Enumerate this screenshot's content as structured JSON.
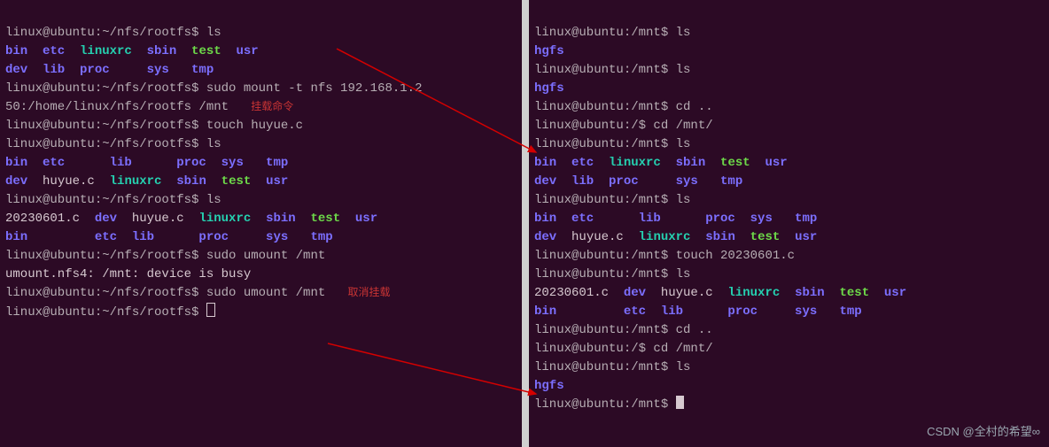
{
  "left": {
    "l1": "linux@ubuntu:~/nfs/rootfs$ ls",
    "ls1_a": "bin  etc  linuxrc  sbin  test  usr",
    "ls1_b": "dev  lib  proc     sys   tmp",
    "l2a": "linux@ubuntu:~/nfs/rootfs$ sudo mount -t nfs 192.168.1.2",
    "l2b": "50:/home/linux/nfs/rootfs /mnt",
    "note1": "挂载命令",
    "l3": "linux@ubuntu:~/nfs/rootfs$ touch huyue.c",
    "l4": "linux@ubuntu:~/nfs/rootfs$ ls",
    "ls2_a": "bin  etc      lib      proc  sys   tmp",
    "ls2_b": "dev  huyue.c  linuxrc  sbin  test  usr",
    "l5": "linux@ubuntu:~/nfs/rootfs$ ls",
    "ls3_a": "20230601.c  dev  huyue.c  linuxrc  sbin  test  usr",
    "ls3_b": "bin         etc  lib      proc     sys   tmp",
    "l6": "linux@ubuntu:~/nfs/rootfs$ sudo umount /mnt",
    "l7": "umount.nfs4: /mnt: device is busy",
    "l8": "linux@ubuntu:~/nfs/rootfs$ sudo umount /mnt",
    "note2": "取消挂载",
    "l9": "linux@ubuntu:~/nfs/rootfs$ "
  },
  "right": {
    "r1": "linux@ubuntu:/mnt$ ls",
    "r1out": "hgfs",
    "r2": "linux@ubuntu:/mnt$ ls",
    "r2out": "hgfs",
    "r3": "linux@ubuntu:/mnt$ cd ..",
    "r4": "linux@ubuntu:/$ cd /mnt/",
    "r5": "linux@ubuntu:/mnt$ ls",
    "rls1_a": "bin  etc  linuxrc  sbin  test  usr",
    "rls1_b": "dev  lib  proc     sys   tmp",
    "r6": "linux@ubuntu:/mnt$ ls",
    "rls2_a": "bin  etc      lib      proc  sys   tmp",
    "rls2_b": "dev  huyue.c  linuxrc  sbin  test  usr",
    "r7": "linux@ubuntu:/mnt$ touch 20230601.c",
    "r8": "linux@ubuntu:/mnt$ ls",
    "rls3_a": "20230601.c  dev  huyue.c  linuxrc  sbin  test  usr",
    "rls3_b": "bin         etc  lib      proc     sys   tmp",
    "r9": "linux@ubuntu:/mnt$ cd ..",
    "r10": "linux@ubuntu:/$ cd /mnt/",
    "r11": "linux@ubuntu:/mnt$ ls",
    "r11out": "hgfs",
    "r12": "linux@ubuntu:/mnt$ "
  },
  "watermark": "CSDN @全村的希望∞"
}
